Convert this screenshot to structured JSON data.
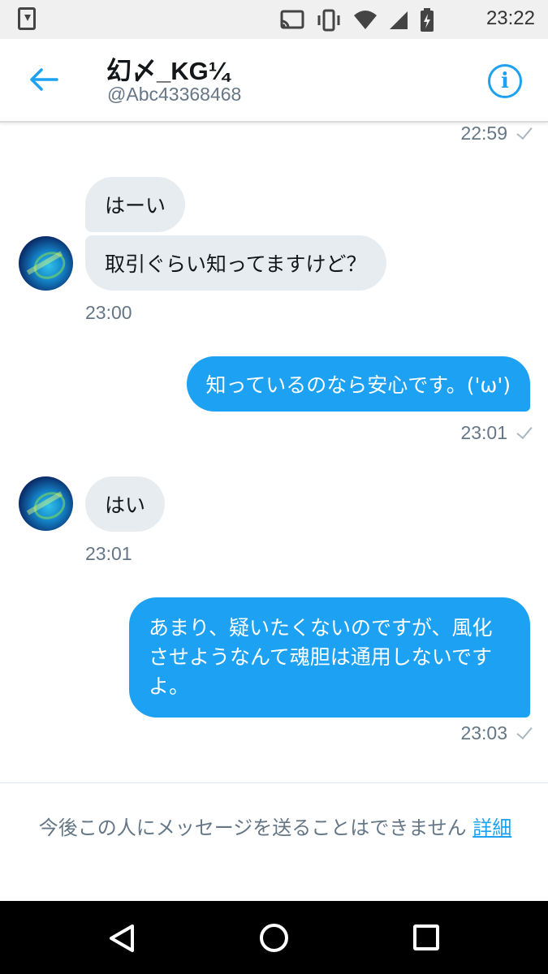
{
  "status_bar": {
    "time": "23:22"
  },
  "header": {
    "name": "幻〆_KG¼",
    "handle": "@Abc43368468",
    "accent_color": "#1da1f2"
  },
  "messages": {
    "top_timestamp": "22:59",
    "group1": {
      "bubble1": "はーい",
      "bubble2": "取引ぐらい知ってますけど？",
      "time": "23:00"
    },
    "out1": {
      "text": "知っているのなら安心です。('ω')",
      "time": "23:01"
    },
    "group2": {
      "bubble1": "はい",
      "time": "23:01"
    },
    "out2": {
      "text": "あまり、疑いたくないのですが、風化させようなんて魂胆は通用しないですよ。",
      "time": "23:03"
    }
  },
  "notice": {
    "text": "今後この人にメッセージを送ることはできません ",
    "link": "詳細"
  }
}
